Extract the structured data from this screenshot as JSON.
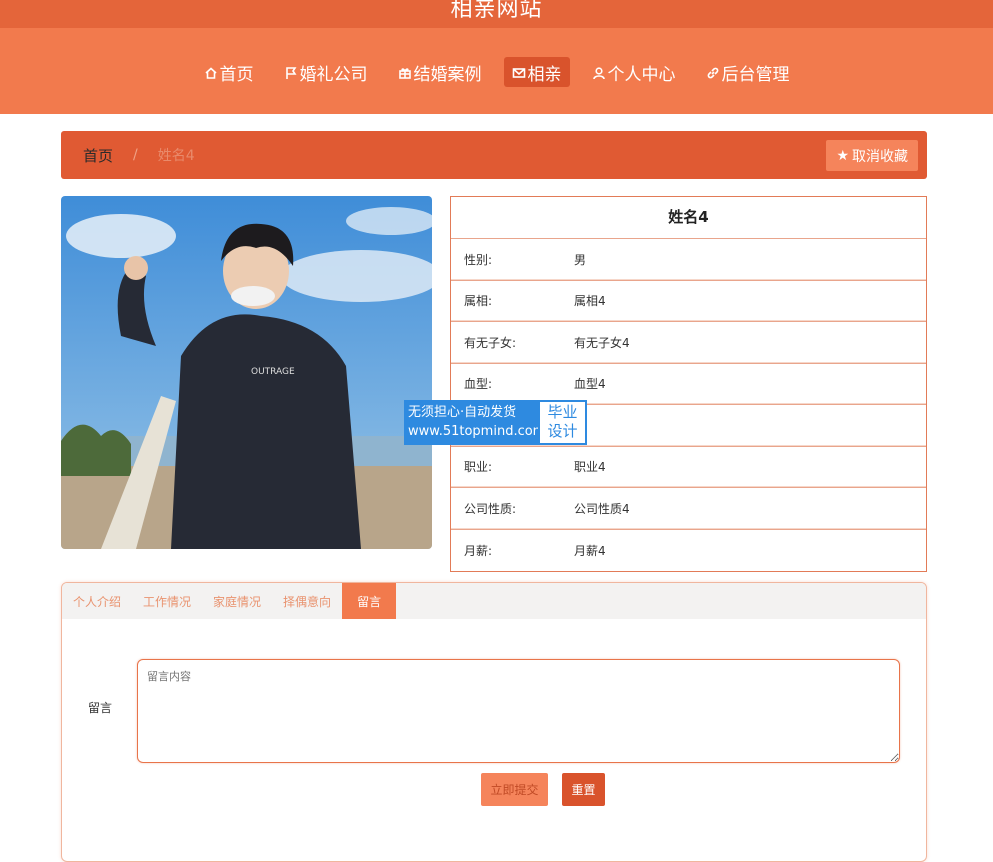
{
  "site": {
    "title": "相亲网站"
  },
  "nav": {
    "items": [
      {
        "label": "首页",
        "icon": "home-icon"
      },
      {
        "label": "婚礼公司",
        "icon": "flag-icon"
      },
      {
        "label": "结婚案例",
        "icon": "gift-icon"
      },
      {
        "label": "相亲",
        "icon": "mail-icon",
        "active": true
      },
      {
        "label": "个人中心",
        "icon": "user-icon"
      },
      {
        "label": "后台管理",
        "icon": "link-icon"
      }
    ]
  },
  "breadcrumb": {
    "home": "首页",
    "separator": "/",
    "current": "姓名4"
  },
  "favorite": {
    "label": "取消收藏",
    "icon": "star-icon"
  },
  "profile": {
    "name": "姓名4",
    "rows": [
      {
        "label": "性别:",
        "value": "男"
      },
      {
        "label": "属相:",
        "value": "属相4"
      },
      {
        "label": "有无子女:",
        "value": "有无子女4"
      },
      {
        "label": "血型:",
        "value": "血型4"
      },
      {
        "label": "",
        "value": ""
      },
      {
        "label": "职业:",
        "value": "职业4"
      },
      {
        "label": "公司性质:",
        "value": "公司性质4"
      },
      {
        "label": "月薪:",
        "value": "月薪4"
      }
    ]
  },
  "watermark": {
    "line1": "无须担心·自动发货",
    "line2": "www.51topmind.com",
    "side1": "毕业",
    "side2": "设计"
  },
  "tabs": {
    "items": [
      "个人介绍",
      "工作情况",
      "家庭情况",
      "择偶意向",
      "留言"
    ],
    "active_index": 4
  },
  "message_form": {
    "label": "留言",
    "placeholder": "留言内容",
    "submit_label": "立即提交",
    "reset_label": "重置"
  },
  "colors": {
    "accent": "#f27a4d",
    "dark_accent": "#e05a33",
    "topbar": "#e4653a",
    "watermark_blue": "#2e8ae0"
  }
}
